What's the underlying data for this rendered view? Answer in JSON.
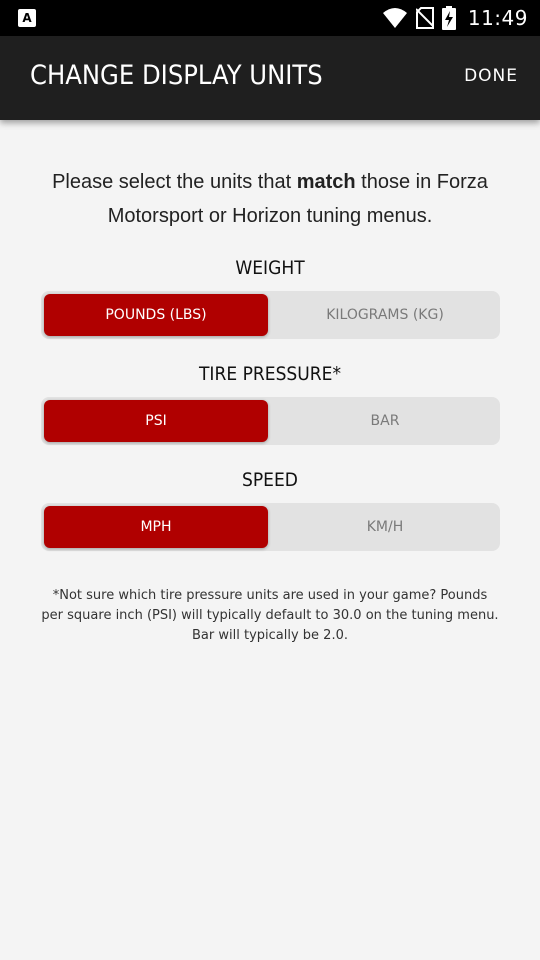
{
  "status_bar": {
    "left_icon": "A",
    "time": "11:49",
    "icons": [
      "notification-a-icon",
      "wifi-icon",
      "no-sim-icon",
      "battery-charging-icon"
    ]
  },
  "app_bar": {
    "title": "CHANGE DISPLAY UNITS",
    "done_label": "DONE"
  },
  "intro": {
    "before": "Please select the units that ",
    "emphasis": "match",
    "after": " those in Forza Motorsport or Horizon tuning menus."
  },
  "sections": {
    "weight": {
      "label": "WEIGHT",
      "options": [
        "POUNDS (LBS)",
        "KILOGRAMS (KG)"
      ],
      "selected": "POUNDS (LBS)"
    },
    "tire_pressure": {
      "label": "TIRE PRESSURE*",
      "options": [
        "PSI",
        "BAR"
      ],
      "selected": "PSI"
    },
    "speed": {
      "label": "SPEED",
      "options": [
        "MPH",
        "KM/H"
      ],
      "selected": "MPH"
    }
  },
  "footnote": "*Not sure which tire pressure units are used in your game? Pounds per square inch (PSI) will typically default to 30.0 on the tuning menu. Bar will typically be 2.0.",
  "colors": {
    "accent": "#b00000",
    "app_bar": "#1f1f1f",
    "background": "#f4f4f4",
    "segment_track": "#e2e2e2"
  }
}
